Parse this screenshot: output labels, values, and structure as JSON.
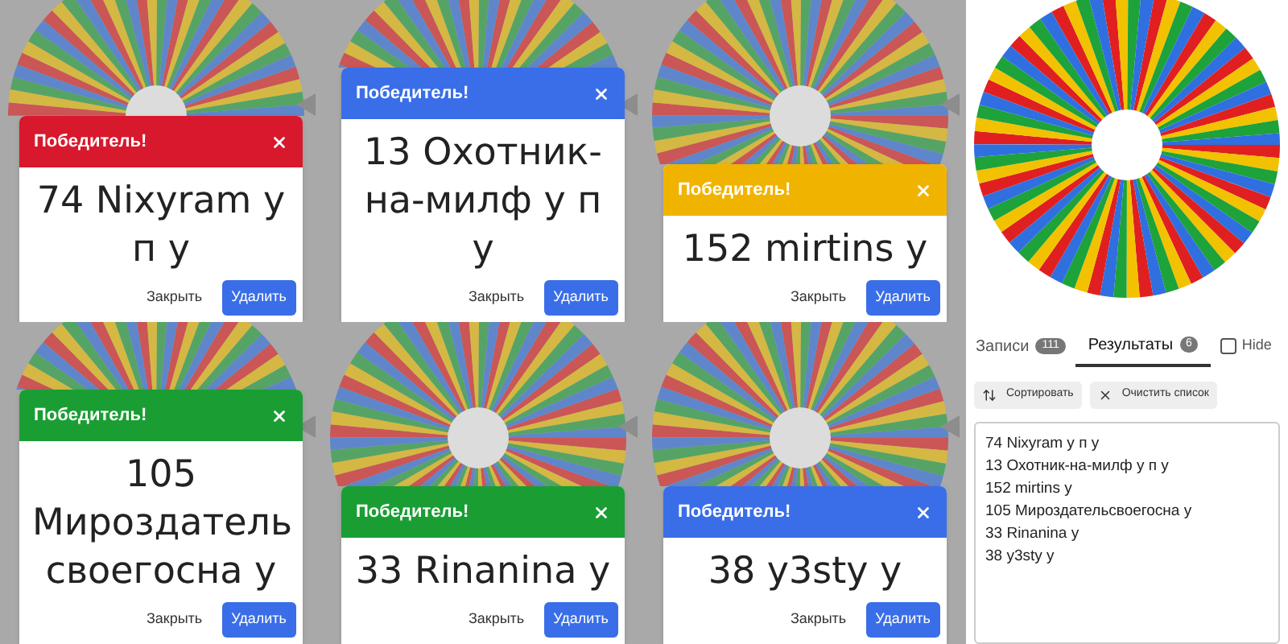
{
  "dialogs": [
    {
      "title": "Победитель!",
      "color": "#d8182c",
      "winner": "74 Nixyram у п у",
      "close": "Закрыть",
      "delete": "Удалить"
    },
    {
      "title": "Победитель!",
      "color": "#3a6ee8",
      "winner": "13 Охотник-на-милф у п у",
      "close": "Закрыть",
      "delete": "Удалить"
    },
    {
      "title": "Победитель!",
      "color": "#f0b400",
      "winner": "152 mirtins у",
      "close": "Закрыть",
      "delete": "Удалить"
    },
    {
      "title": "Победитель!",
      "color": "#1a9e34",
      "winner": "105 Мироздатель своегосна у",
      "close": "Закрыть",
      "delete": "Удалить"
    },
    {
      "title": "Победитель!",
      "color": "#1a9e34",
      "winner": "33 Rinanina у",
      "close": "Закрыть",
      "delete": "Удалить"
    },
    {
      "title": "Победитель!",
      "color": "#3a6ee8",
      "winner": "38 y3sty у",
      "close": "Закрыть",
      "delete": "Удалить"
    }
  ],
  "panel": {
    "tabs": [
      {
        "label": "Записи",
        "count": "111",
        "selected": false
      },
      {
        "label": "Результаты",
        "count": "6",
        "selected": true
      }
    ],
    "hide": {
      "label": "Hide",
      "checked": false
    },
    "buttons": [
      {
        "kind": "sort",
        "label": "Сортировать"
      },
      {
        "kind": "clear",
        "label": "Очистить список"
      }
    ],
    "results": [
      "74 Nixyram у п у",
      "13 Охотник-на-милф у п у",
      "152 mirtins у",
      "105 Мироздательсвоегосна у",
      "33 Rinanina у",
      "38 y3sty у"
    ]
  }
}
